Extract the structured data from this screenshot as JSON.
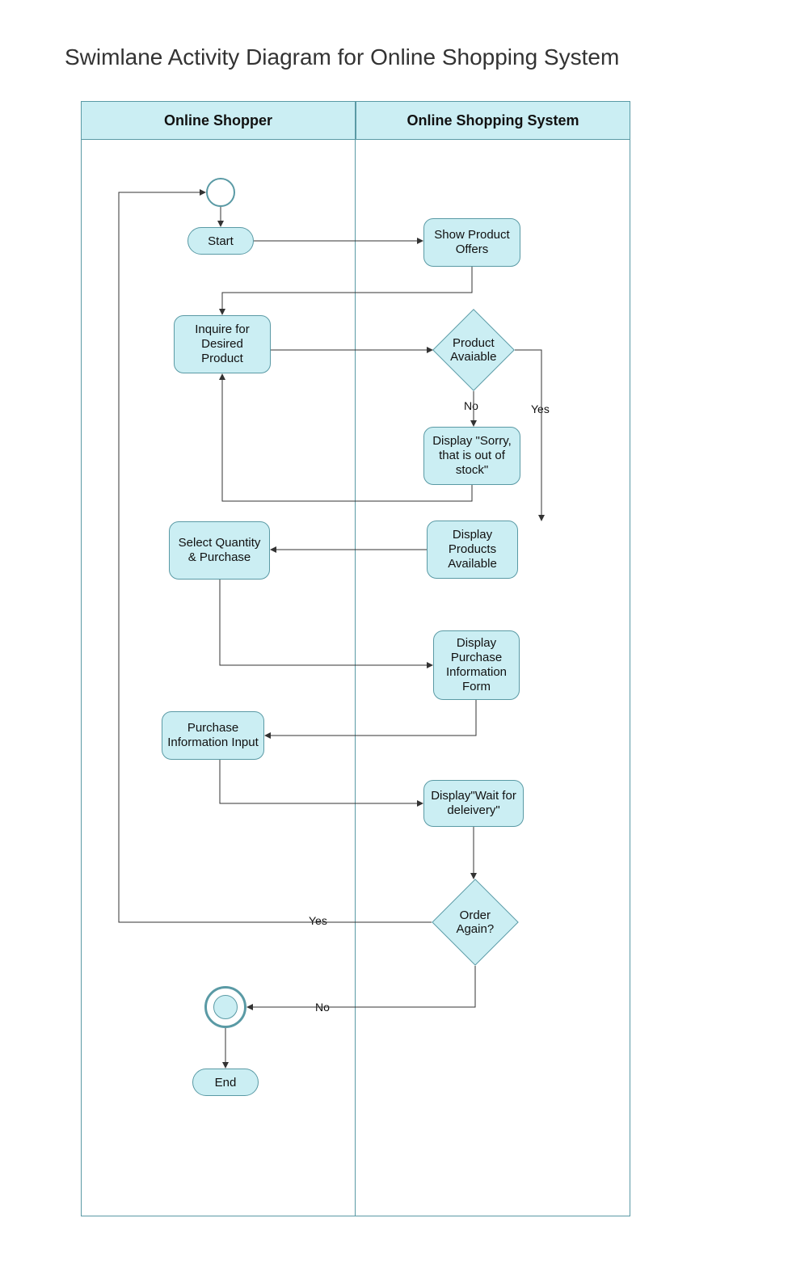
{
  "title": "Swimlane Activity Diagram for Online Shopping System",
  "lanes": {
    "lane1": "Online Shopper",
    "lane2": "Online Shopping System"
  },
  "nodes": {
    "start_pill": "Start",
    "end_pill": "End",
    "show_offers": "Show Product Offers",
    "inquire": "Inquire for Desired Product",
    "product_avail": "Product Avaiable",
    "out_of_stock": "Display \"Sorry, that is out of stock\"",
    "select_qty": "Select Quantity & Purchase",
    "display_products": "Display Products Available",
    "display_form": "Display Purchase Information Form",
    "purchase_input": "Purchase Information Input",
    "wait_delivery": "Display\"Wait for deleivery\"",
    "order_again": "Order Again?"
  },
  "labels": {
    "no": "No",
    "yes": "Yes",
    "yes2": "Yes",
    "no2": "No"
  }
}
